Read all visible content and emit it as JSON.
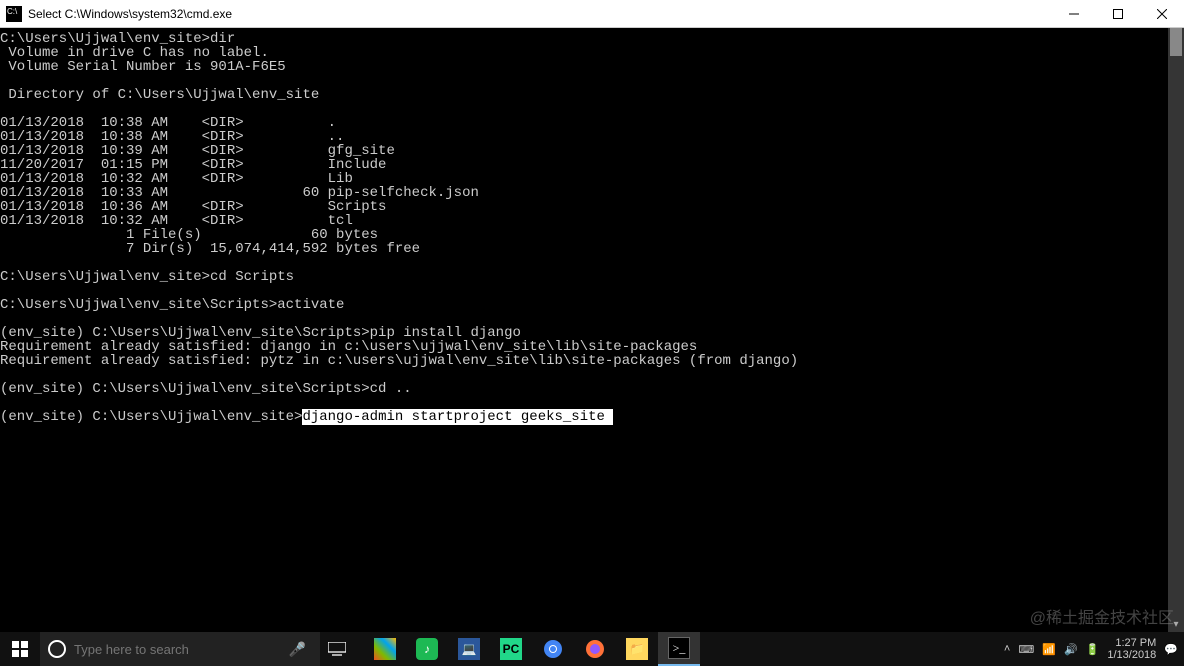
{
  "window": {
    "title": "Select C:\\Windows\\system32\\cmd.exe"
  },
  "console": {
    "line1": "C:\\Users\\Ujjwal\\env_site>dir",
    "line2": " Volume in drive C has no label.",
    "line3": " Volume Serial Number is 901A-F6E5",
    "line4": "",
    "line5": " Directory of C:\\Users\\Ujjwal\\env_site",
    "line6": "",
    "dir1": "01/13/2018  10:38 AM    <DIR>          .",
    "dir2": "01/13/2018  10:38 AM    <DIR>          ..",
    "dir3": "01/13/2018  10:39 AM    <DIR>          gfg_site",
    "dir4": "11/20/2017  01:15 PM    <DIR>          Include",
    "dir5": "01/13/2018  10:32 AM    <DIR>          Lib",
    "dir6": "01/13/2018  10:33 AM                60 pip-selfcheck.json",
    "dir7": "01/13/2018  10:36 AM    <DIR>          Scripts",
    "dir8": "01/13/2018  10:32 AM    <DIR>          tcl",
    "sum1": "               1 File(s)             60 bytes",
    "sum2": "               7 Dir(s)  15,074,414,592 bytes free",
    "blank1": "",
    "cmd2": "C:\\Users\\Ujjwal\\env_site>cd Scripts",
    "blank2": "",
    "cmd3": "C:\\Users\\Ujjwal\\env_site\\Scripts>activate",
    "blank3": "",
    "cmd4": "(env_site) C:\\Users\\Ujjwal\\env_site\\Scripts>pip install django",
    "req1": "Requirement already satisfied: django in c:\\users\\ujjwal\\env_site\\lib\\site-packages",
    "req2": "Requirement already satisfied: pytz in c:\\users\\ujjwal\\env_site\\lib\\site-packages (from django)",
    "blank4": "",
    "cmd5": "(env_site) C:\\Users\\Ujjwal\\env_site\\Scripts>cd ..",
    "blank5": "",
    "prompt6": "(env_site) C:\\Users\\Ujjwal\\env_site>",
    "sel6": "django-admin startproject geeks_site "
  },
  "taskbar": {
    "search_placeholder": "Type here to search",
    "time": "1:27 PM",
    "date": "1/13/2018"
  },
  "watermark": "@稀土掘金技术社区"
}
